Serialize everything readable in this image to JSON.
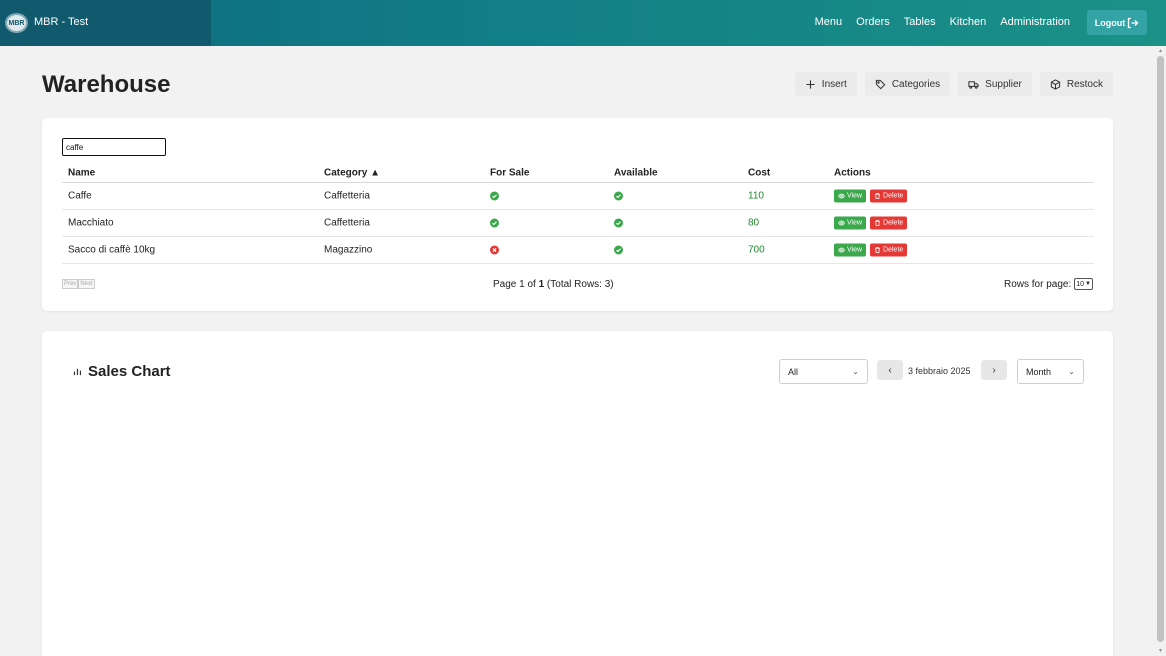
{
  "app": {
    "logo_text": "MBR",
    "title": "MBR - Test",
    "nav": [
      "Menu",
      "Orders",
      "Tables",
      "Kitchen",
      "Administration"
    ],
    "logout_label": "Logout"
  },
  "page": {
    "title": "Warehouse",
    "actions": {
      "insert": "Insert",
      "categories": "Categories",
      "supplier": "Supplier",
      "restock": "Restock"
    }
  },
  "table": {
    "search_value": "caffe",
    "columns": {
      "name": "Name",
      "category": "Category ▲",
      "for_sale": "For Sale",
      "available": "Available",
      "cost": "Cost",
      "actions": "Actions"
    },
    "rows": [
      {
        "name": "Caffe",
        "category": "Caffetteria",
        "for_sale": true,
        "available": true,
        "cost": "110"
      },
      {
        "name": "Macchiato",
        "category": "Caffetteria",
        "for_sale": true,
        "available": true,
        "cost": "80"
      },
      {
        "name": "Sacco di caffè 10kg",
        "category": "Magazzino",
        "for_sale": false,
        "available": true,
        "cost": "700"
      }
    ],
    "view_label": "View",
    "delete_label": "Delete",
    "pager": {
      "prev": "Prev",
      "next": "Next",
      "info_prefix": "Page 1 of ",
      "info_total": "1",
      "info_suffix": " (Total Rows: 3)",
      "rows_per_page_label": "Rows for page:",
      "rows_per_page_value": "10"
    }
  },
  "sales": {
    "title": "Sales Chart",
    "filter_value": "All",
    "date": "3 febbraio 2025",
    "period_value": "Month"
  },
  "colors": {
    "navbar_start": "#0d6a80",
    "navbar_end": "#1b9187",
    "success": "#3aa84b",
    "danger": "#e53935",
    "cost_text": "#1f8a2e"
  }
}
